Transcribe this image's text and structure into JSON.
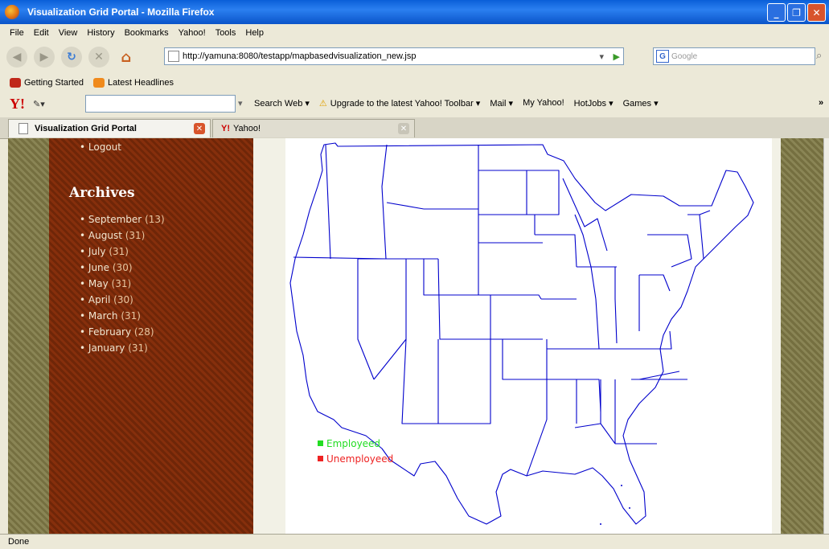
{
  "window": {
    "title": "Visualization Grid Portal - Mozilla Firefox",
    "min": "_",
    "max": "❐",
    "close": "✕"
  },
  "menu": [
    "File",
    "Edit",
    "View",
    "History",
    "Bookmarks",
    "Yahoo!",
    "Tools",
    "Help"
  ],
  "nav": {
    "url": "http://yamuna:8080/testapp/mapbasedvisualization_new.jsp",
    "search_placeholder": "Google"
  },
  "bookmarks": [
    "Getting Started",
    "Latest Headlines"
  ],
  "yahoo_toolbar": {
    "logo": "Y!",
    "items": [
      "Search Web ▾",
      "Upgrade to the latest Yahoo! Toolbar ▾",
      "Mail ▾",
      "My Yahoo!",
      "HotJobs ▾",
      "Games ▾"
    ],
    "more": "»"
  },
  "tabs": [
    {
      "label": "Visualization Grid Portal",
      "active": true
    },
    {
      "label": "Yahoo!",
      "active": false
    }
  ],
  "sidebar": {
    "logout": "Logout",
    "archives_title": "Archives",
    "archives": [
      {
        "month": "September",
        "count": "(13)"
      },
      {
        "month": "August",
        "count": "(31)"
      },
      {
        "month": "July",
        "count": "(31)"
      },
      {
        "month": "June",
        "count": "(30)"
      },
      {
        "month": "May",
        "count": "(31)"
      },
      {
        "month": "April",
        "count": "(30)"
      },
      {
        "month": "March",
        "count": "(31)"
      },
      {
        "month": "February",
        "count": "(28)"
      },
      {
        "month": "January",
        "count": "(31)"
      }
    ]
  },
  "map": {
    "legend": [
      {
        "label": "Employeed",
        "color": "#22dd22"
      },
      {
        "label": "Unemployeed",
        "color": "#ee2222"
      }
    ],
    "border_color": "#0000cc"
  },
  "status": "Done"
}
